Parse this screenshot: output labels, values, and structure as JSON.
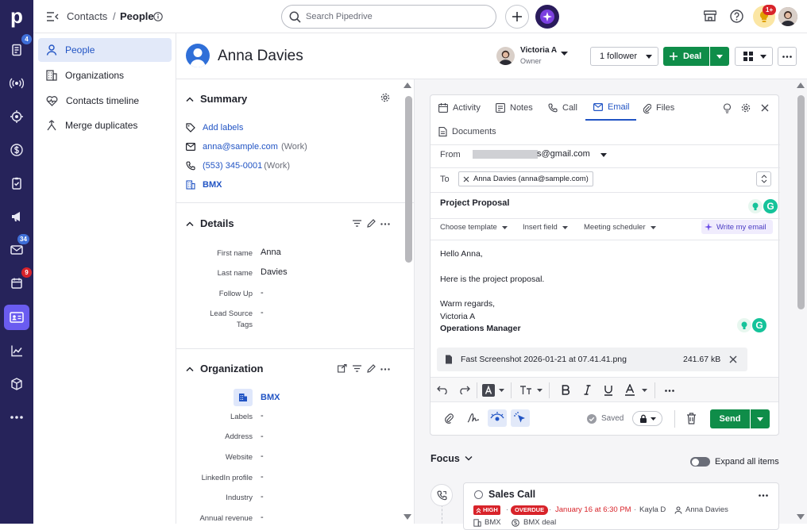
{
  "rail": {
    "logo": "p",
    "badges": {
      "leads": "4",
      "mail": "34",
      "activities": "9"
    }
  },
  "topbar": {
    "breadcrumb_parent": "Contacts",
    "breadcrumb_sep": "/",
    "breadcrumb_current": "People",
    "search_placeholder": "Search Pipedrive",
    "notif_badge": "1+"
  },
  "subnav": {
    "items": [
      {
        "label": "People",
        "icon": "person-icon"
      },
      {
        "label": "Organizations",
        "icon": "building-icon"
      },
      {
        "label": "Contacts timeline",
        "icon": "heart-pulse-icon"
      },
      {
        "label": "Merge duplicates",
        "icon": "merge-icon"
      }
    ]
  },
  "person": {
    "name": "Anna Davies",
    "owner_name": "Victoria A",
    "owner_role": "Owner",
    "follower_label": "1 follower",
    "deal_label": "Deal"
  },
  "summary": {
    "title": "Summary",
    "add_labels": "Add labels",
    "email": "anna@sample.com",
    "email_type": "(Work)",
    "phone": "(553) 345-0001",
    "phone_type": "(Work)",
    "org": "BMX"
  },
  "details": {
    "title": "Details",
    "fields": [
      {
        "label": "First name",
        "value": "Anna"
      },
      {
        "label": "Last name",
        "value": "Davies"
      },
      {
        "label": "Follow Up",
        "value": "-"
      },
      {
        "label": "Lead Source",
        "label2": "Tags",
        "value": "-"
      }
    ]
  },
  "organization": {
    "title": "Organization",
    "name": "BMX",
    "fields": [
      {
        "label": "Labels",
        "value": "-"
      },
      {
        "label": "Address",
        "value": "-"
      },
      {
        "label": "Website",
        "value": "-"
      },
      {
        "label": "LinkedIn profile",
        "value": "-"
      },
      {
        "label": "Industry",
        "value": "-"
      },
      {
        "label": "Annual revenue",
        "value": "-"
      }
    ]
  },
  "composer": {
    "tabs": [
      "Activity",
      "Notes",
      "Call",
      "Email",
      "Files",
      "Documents"
    ],
    "active_tab": "Email",
    "from_label": "From",
    "from_value": "s@gmail.com",
    "to_label": "To",
    "to_value": "Anna Davies (anna@sample.com)",
    "subject": "Project Proposal",
    "toolbar": {
      "template": "Choose template",
      "insert_field": "Insert field",
      "scheduler": "Meeting scheduler",
      "ai": "Write my email"
    },
    "body": {
      "greeting": "Hello Anna,",
      "line1": "Here is the project proposal.",
      "closing": "Warm regards,",
      "sig_name": "Victoria A",
      "sig_title": "Operations Manager"
    },
    "attachment": {
      "name": "Fast Screenshot 2026-01-21 at 07.41.41.png",
      "size": "241.67 kB"
    },
    "saved_label": "Saved",
    "send_label": "Send",
    "grammarly_letter": "G"
  },
  "focus": {
    "title": "Focus",
    "expand_label": "Expand all items",
    "item": {
      "title": "Sales Call",
      "priority": "HIGH",
      "status": "OVERDUE",
      "due": "January 16 at 6:30 PM",
      "assignee": "Kayla D",
      "person": "Anna Davies",
      "org": "BMX",
      "deal": "BMX deal"
    }
  },
  "colors": {
    "rail": "#26235a",
    "accent": "#2154c4",
    "green": "#0f8d49",
    "red": "#d8232a"
  }
}
